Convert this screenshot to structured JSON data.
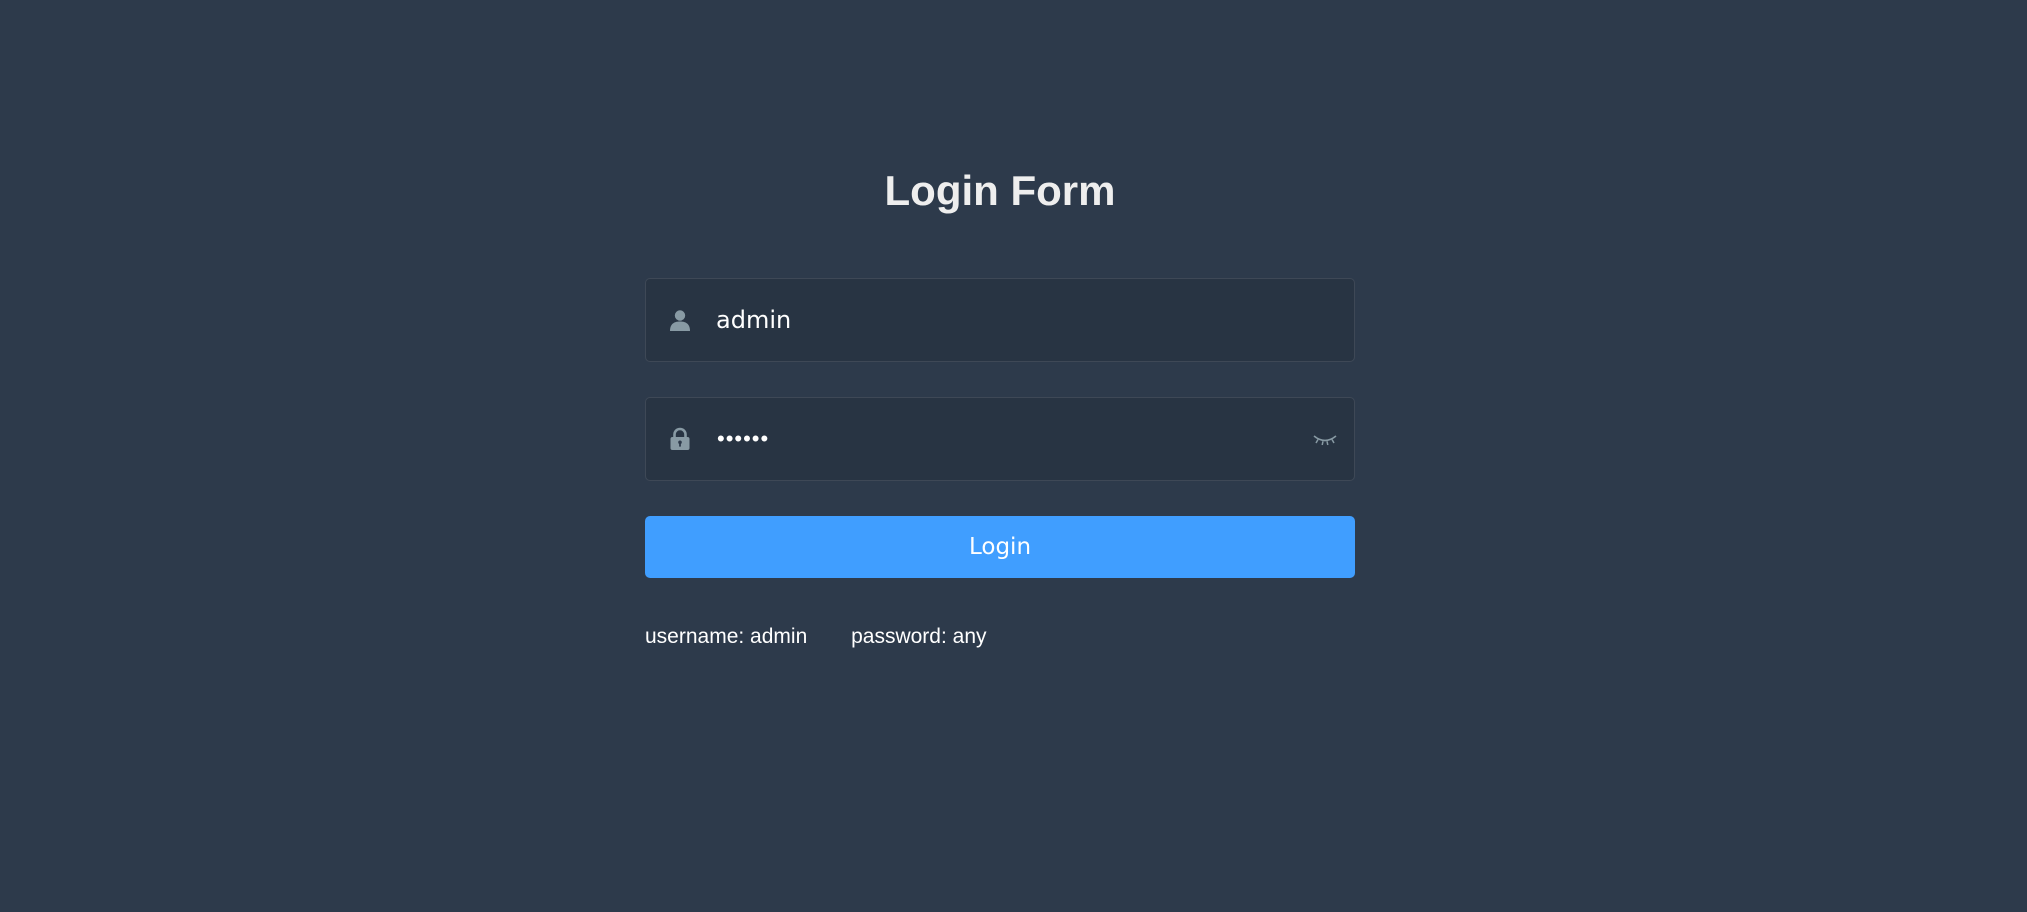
{
  "title": "Login Form",
  "username": {
    "value": "admin",
    "icon": "user-icon"
  },
  "password": {
    "masked_value": "••••••",
    "icon": "lock-icon",
    "toggle_icon": "eye-closed-icon"
  },
  "login_button": {
    "label": "Login",
    "color": "#409eff"
  },
  "tips": {
    "username": "username: admin",
    "password": "password: any"
  },
  "colors": {
    "background": "#2d3a4b",
    "title": "#eeeeee",
    "icon": "#889aa4"
  }
}
